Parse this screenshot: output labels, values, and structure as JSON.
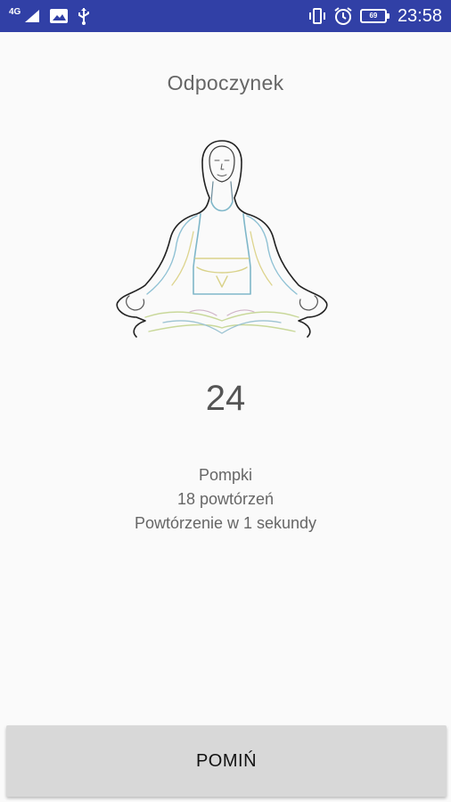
{
  "status_bar": {
    "network_type": "4G",
    "time": "23:58",
    "battery_level": "69",
    "icons": [
      "signal-icon",
      "image-icon",
      "usb-icon",
      "vibrate-icon",
      "alarm-icon",
      "battery-icon"
    ]
  },
  "screen": {
    "title": "Odpoczynek",
    "counter": "24",
    "exercise_name": "Pompki",
    "repetitions": "18 powtórzeń",
    "repetition_info": "Powtórzenie w 1 sekundy"
  },
  "skip_button": {
    "label": "POMIŃ"
  },
  "colors": {
    "status_bar": "#3140a6",
    "background": "#fafafa",
    "button": "#d8d8d8"
  }
}
